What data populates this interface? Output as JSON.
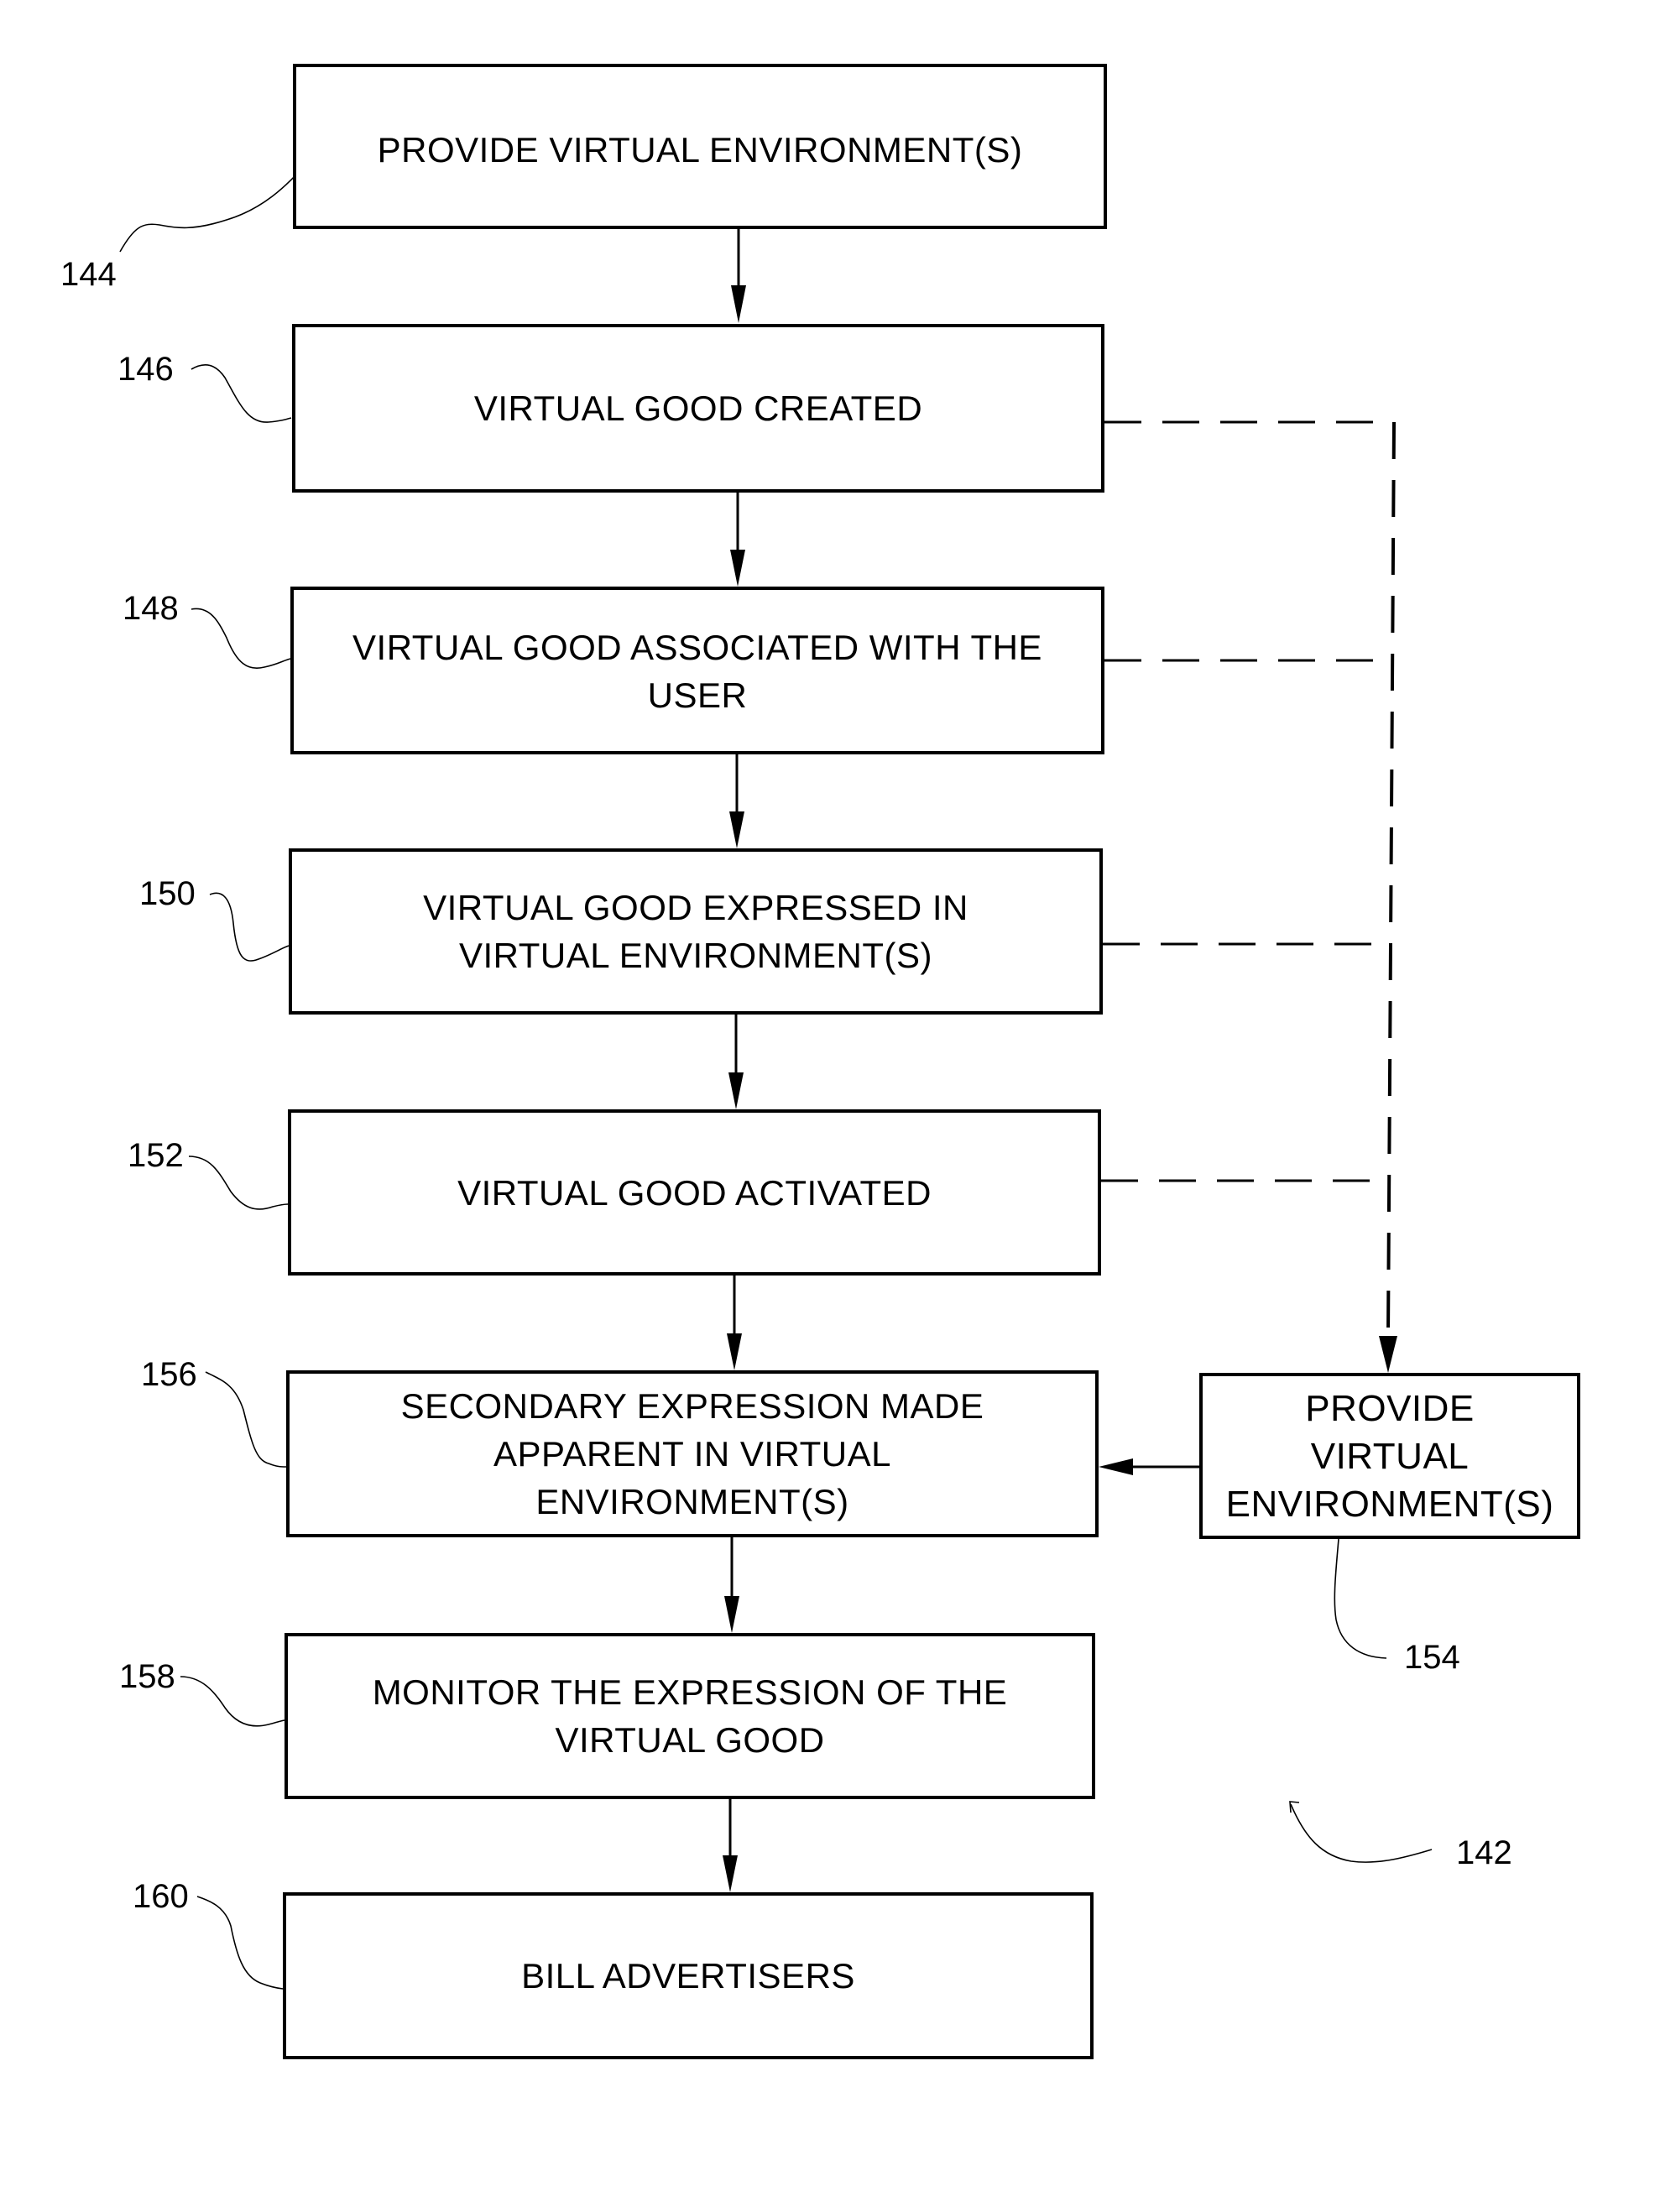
{
  "figure": {
    "reference": "142",
    "steps": [
      {
        "ref": "144",
        "lines": [
          "PROVIDE VIRTUAL ENVIRONMENT(S)"
        ]
      },
      {
        "ref": "146",
        "lines": [
          "VIRTUAL GOOD CREATED"
        ]
      },
      {
        "ref": "148",
        "lines": [
          "VIRTUAL GOOD ASSOCIATED WITH THE",
          "USER"
        ]
      },
      {
        "ref": "150",
        "lines": [
          "VIRTUAL GOOD EXPRESSED IN",
          "VIRTUAL ENVIRONMENT(S)"
        ]
      },
      {
        "ref": "152",
        "lines": [
          "VIRTUAL GOOD ACTIVATED"
        ]
      },
      {
        "ref": "156",
        "lines": [
          "SECONDARY EXPRESSION MADE",
          "APPARENT IN VIRTUAL",
          "ENVIRONMENT(S)"
        ]
      },
      {
        "ref": "158",
        "lines": [
          "MONITOR THE EXPRESSION OF THE",
          "VIRTUAL GOOD"
        ]
      },
      {
        "ref": "160",
        "lines": [
          "BILL ADVERTISERS"
        ]
      }
    ],
    "side_step": {
      "ref": "154",
      "lines": [
        "PROVIDE",
        "VIRTUAL",
        "ENVIRONMENT(S)"
      ]
    },
    "line_color": "#000000",
    "background": "#ffffff"
  }
}
